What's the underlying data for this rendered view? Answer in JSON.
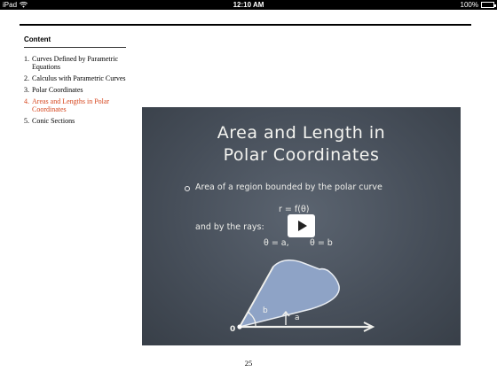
{
  "status_bar": {
    "device": "iPad",
    "time": "12:10 AM",
    "battery": "100%"
  },
  "toc": {
    "heading": "Content",
    "items": [
      {
        "num": "1.",
        "label": "Curves Defined by Parametric Equations",
        "active": false
      },
      {
        "num": "2.",
        "label": "Calculus with Parametric Curves",
        "active": false
      },
      {
        "num": "3.",
        "label": "Polar Coordinates",
        "active": false
      },
      {
        "num": "4.",
        "label": "Areas and Lengths in Polar Coordinates",
        "active": true
      },
      {
        "num": "5.",
        "label": "Conic Sections",
        "active": false
      }
    ]
  },
  "slide": {
    "title_line1": "Area and Length in",
    "title_line2": "Polar Coordinates",
    "bullet": "Area of a region bounded by the polar curve",
    "equation1": "r = f(θ)",
    "rays_text": "and by the rays:",
    "equation2": "θ = a,",
    "equation3": "θ = b",
    "label_origin": "0",
    "label_b": "b",
    "label_a": "a"
  },
  "page": {
    "number": "25"
  },
  "colors": {
    "active_toc": "#d6461e",
    "region_fill": "#8ea3c6",
    "chalkboard": "#474f5a"
  }
}
